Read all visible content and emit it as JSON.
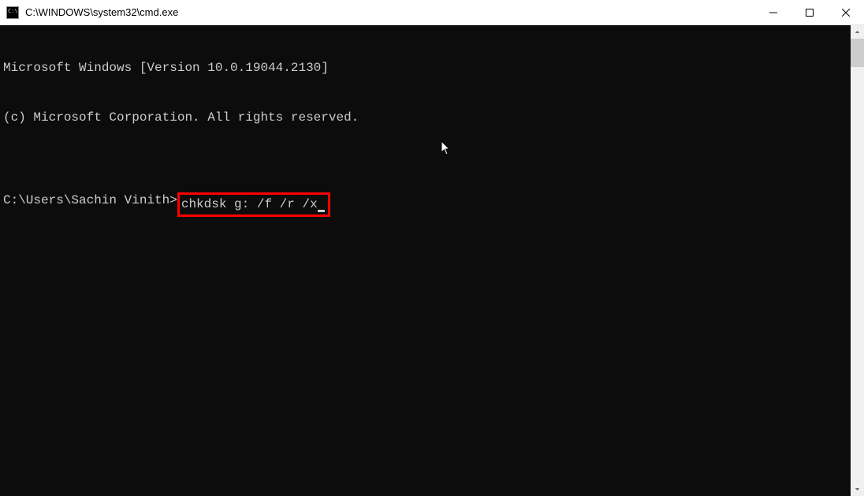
{
  "window": {
    "title": "C:\\WINDOWS\\system32\\cmd.exe"
  },
  "terminal": {
    "line1": "Microsoft Windows [Version 10.0.19044.2130]",
    "line2": "(c) Microsoft Corporation. All rights reserved.",
    "blank": "",
    "prompt": "C:\\Users\\Sachin Vinith>",
    "command": "chkdsk g: /f /r /x"
  }
}
